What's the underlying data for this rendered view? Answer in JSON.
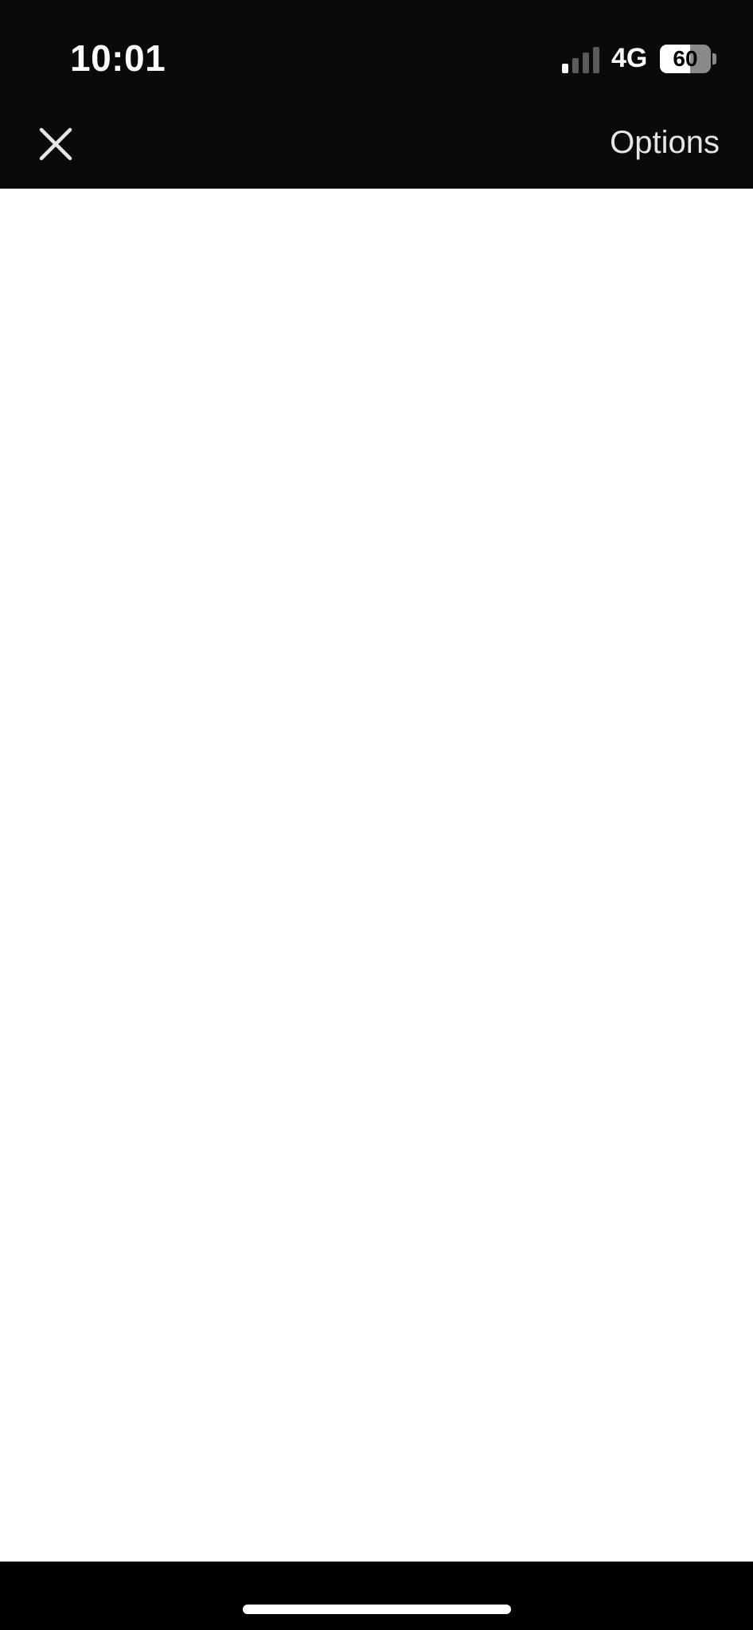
{
  "status_bar": {
    "time": "10:01",
    "network": "4G",
    "battery": "60",
    "battery_level": 0.6,
    "signal_bars_active": 1,
    "signal_bars_total": 4
  },
  "header": {
    "close_icon": "close-icon",
    "options_label": "Options"
  },
  "colors": {
    "header_bg": "#0a0a0a",
    "content_bg": "#ffffff",
    "text_primary": "#ffffff",
    "text_secondary": "#e6e6e6",
    "signal_active": "#ffffff",
    "signal_inactive": "#5a5a5a"
  }
}
